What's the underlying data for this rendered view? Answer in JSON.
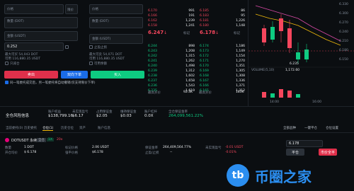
{
  "left_panel": {
    "price_label": "价格",
    "trigger_price_label": "价格",
    "amount_label": "数量 (DOT)",
    "total_label": "金额 (USDT)",
    "amount2_label": "数量 (DOT)",
    "total2_label": "金额 (USDT)",
    "total2_value": "0.252",
    "limit_label": "限价",
    "avail_label": "可用余额",
    "buy_max": "最大可买 54,043 DOT",
    "buy_avail": "可用 116,880.35 USDT",
    "sell_max": "最大可卖 54,071 DOT",
    "sell_avail": "可用 116,880.35 USDT",
    "tp_sl": "止盈止损",
    "post_only": "只减仓",
    "confirm_text": "同一笔委托成交后，另一笔委托将自动撤销(仅支持限价下单)",
    "btn_sell": "卖出",
    "btn_mid": "双向下单",
    "btn_buy": "买入"
  },
  "orderbook": {
    "asks": [
      {
        "price": "6.170",
        "amount": "991"
      },
      {
        "price": "6.166",
        "amount": "191"
      },
      {
        "price": "6.162",
        "amount": "1,239"
      },
      {
        "price": "6.158",
        "amount": "1,241"
      }
    ],
    "asks_right": [
      {
        "price": "6.185",
        "amount": "86"
      },
      {
        "price": "6.183",
        "amount": "95"
      },
      {
        "price": "6.181",
        "amount": "1,226"
      },
      {
        "price": "6.180",
        "amount": "1,148"
      }
    ],
    "mid_price_left": "6.247",
    "mid_price_left_arrow": "↓",
    "mid_price_right": "6.178",
    "mid_price_right_arrow": "↓",
    "mark_left": "标记",
    "mark_right": "标记",
    "bids": [
      {
        "price": "6.244",
        "amount": "898"
      },
      {
        "price": "6.243",
        "amount": "1,208"
      },
      {
        "price": "6.242",
        "amount": "1,315"
      },
      {
        "price": "6.241",
        "amount": "1,262"
      },
      {
        "price": "6.240",
        "amount": "1,498"
      },
      {
        "price": "6.239",
        "amount": "1,312"
      },
      {
        "price": "6.238",
        "amount": "1,602"
      },
      {
        "price": "6.237",
        "amount": "1,658"
      },
      {
        "price": "6.236",
        "amount": "1,543"
      },
      {
        "price": "6.235",
        "amount": "1,619"
      }
    ],
    "bids_right": [
      {
        "price": "6.174",
        "amount": "1,186"
      },
      {
        "price": "6.173",
        "amount": "1,149"
      },
      {
        "price": "6.172",
        "amount": "1,154"
      },
      {
        "price": "6.171",
        "amount": "1,270"
      },
      {
        "price": "6.170",
        "amount": "1,351"
      },
      {
        "price": "6.169",
        "amount": "1,305"
      },
      {
        "price": "6.168",
        "amount": "1,308"
      },
      {
        "price": "6.167",
        "amount": "1,336"
      },
      {
        "price": "6.166",
        "amount": "1,371"
      },
      {
        "price": "6.165",
        "amount": "1,312"
      }
    ],
    "footer_left": "最高买价",
    "footer_left_val": "92.3K",
    "footer_right": "最高买价",
    "footer_right_val": "183K"
  },
  "chart": {
    "price_tags": [
      "6.330",
      "6.300",
      "6.270",
      "6.240",
      "6.210",
      "6.180",
      "6.150"
    ],
    "low_label": "6.235",
    "volume_label": "VOLUME(5,10)",
    "vol_value": "1,172.60",
    "time_left": "14:00",
    "time_right": "16:00"
  },
  "risk": {
    "title": "全仓风险信息",
    "items": [
      {
        "label": "账户权益",
        "value": "$138,799.16"
      },
      {
        "label": "未实现盈亏",
        "value": "$6.17"
      },
      {
        "label": "占用保证金",
        "value": "$2.05"
      },
      {
        "label": "维持保证金",
        "value": "$0.03"
      },
      {
        "label": "账户杠杆",
        "value": "0.0X"
      },
      {
        "label": "全仓保证金率",
        "value": "264,099,561.22%"
      }
    ]
  },
  "bottom_tabs": [
    "当前委托(0)",
    "历史委托",
    "仓位(1)",
    "历史仓位",
    "资产",
    "账户信息"
  ],
  "bottom_controls": {
    "filter": "全部品种",
    "close_all": "一键平仓",
    "settings": "仓位设置"
  },
  "position": {
    "symbol": "DOTUSDT 永续",
    "symbol_badge1": "全仓",
    "symbol_badge2": "1X",
    "symbol_tag": "20x",
    "qty_label": "数量",
    "qty_value": "1 DOT",
    "entry_label": "开仓均价",
    "entry_value": "$ 6.178",
    "mark_label": "标记价格",
    "mark_value": "2.06 USDT",
    "liq_label": "强平价格",
    "liq_value": "$6.178",
    "margin_label": "保证金率",
    "margin_value": "264,409,564.77%",
    "pnl_label": "未实现盈亏",
    "pnl_value": "-0.01 USDT",
    "pnl_pct": "-0.01%",
    "tp_label": "止盈/止损",
    "tp_value": "--",
    "close_input": "6.178",
    "btn_close_limit": "平仓",
    "btn_close_market": "市价全平"
  },
  "watermark": {
    "text": "币圈之家"
  }
}
